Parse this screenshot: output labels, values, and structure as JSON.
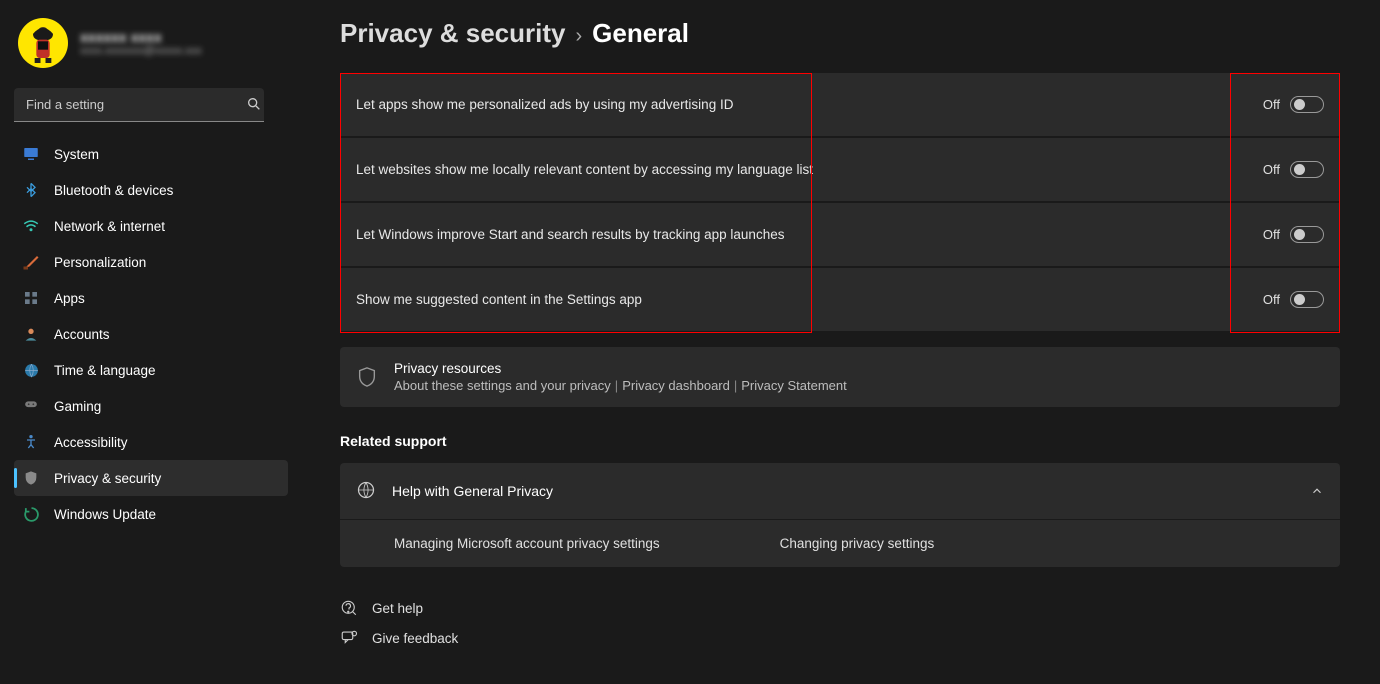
{
  "profile": {
    "name": "xxxxxx xxxx",
    "email": "xxxx.xxxxxxx@xxxxx.xxx"
  },
  "search": {
    "placeholder": "Find a setting"
  },
  "nav": [
    {
      "id": "system",
      "label": "System"
    },
    {
      "id": "bluetooth",
      "label": "Bluetooth & devices"
    },
    {
      "id": "network",
      "label": "Network & internet"
    },
    {
      "id": "personalization",
      "label": "Personalization"
    },
    {
      "id": "apps",
      "label": "Apps"
    },
    {
      "id": "accounts",
      "label": "Accounts"
    },
    {
      "id": "time",
      "label": "Time & language"
    },
    {
      "id": "gaming",
      "label": "Gaming"
    },
    {
      "id": "accessibility",
      "label": "Accessibility"
    },
    {
      "id": "privacy",
      "label": "Privacy & security",
      "active": true
    },
    {
      "id": "update",
      "label": "Windows Update"
    }
  ],
  "breadcrumb": {
    "parent": "Privacy & security",
    "sep": "›",
    "current": "General"
  },
  "toggles": [
    {
      "label": "Let apps show me personalized ads by using my advertising ID",
      "state": "Off"
    },
    {
      "label": "Let websites show me locally relevant content by accessing my language list",
      "state": "Off"
    },
    {
      "label": "Let Windows improve Start and search results by tracking app launches",
      "state": "Off"
    },
    {
      "label": "Show me suggested content in the Settings app",
      "state": "Off"
    }
  ],
  "privacy_card": {
    "title": "Privacy resources",
    "sub1": "About these settings and your privacy",
    "sub2": "Privacy dashboard",
    "sub3": "Privacy Statement"
  },
  "related": {
    "heading": "Related support",
    "expander_title": "Help with General Privacy",
    "link1": "Managing Microsoft account privacy settings",
    "link2": "Changing privacy settings"
  },
  "footer": {
    "help": "Get help",
    "feedback": "Give feedback"
  }
}
